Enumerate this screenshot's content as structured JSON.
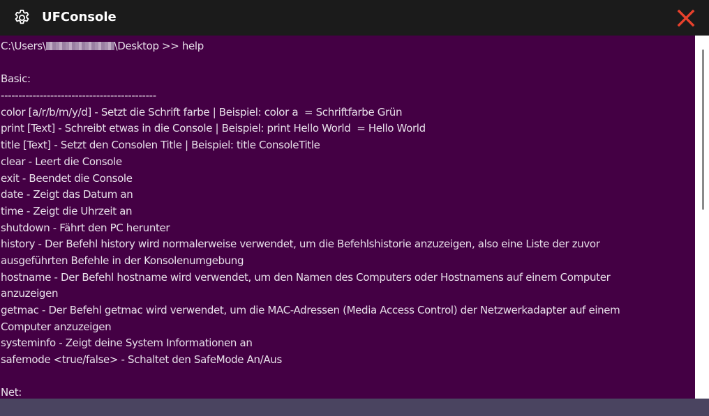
{
  "window": {
    "title": "UFConsole",
    "icon": "gear-icon",
    "close_icon": "close-icon",
    "colors": {
      "titlebar_bg": "#1b1b1b",
      "console_bg": "#440044",
      "console_text": "#e8e0ea",
      "close": "#e8412c",
      "footer_bg": "#4a4460"
    }
  },
  "console": {
    "prompt_prefix": "C:\\Users\\",
    "prompt_suffix": "\\Desktop >> help",
    "lines": [
      "",
      "Basic:",
      "--------------------------------------------",
      "color [a/r/b/m/y/d] - Setzt die Schrift farbe | Beispiel: color a  = Schriftfarbe Grün",
      "print [Text] - Schreibt etwas in die Console | Beispiel: print Hello World  = Hello World",
      "title [Text] - Setzt den Consolen Title | Beispiel: title ConsoleTitle",
      "clear - Leert die Console",
      "exit - Beendet die Console",
      "date - Zeigt das Datum an",
      "time - Zeigt die Uhrzeit an",
      "shutdown - Fährt den PC herunter",
      "history - Der Befehl history wird normalerweise verwendet, um die Befehlshistorie anzuzeigen, also eine Liste der zuvor",
      "ausgeführten Befehle in der Konsolenumgebung",
      "hostname - Der Befehl hostname wird verwendet, um den Namen des Computers oder Hostnamens auf einem Computer",
      "anzuzeigen",
      "getmac - Der Befehl getmac wird verwendet, um die MAC-Adressen (Media Access Control) der Netzwerkadapter auf einem",
      "Computer anzuzeigen",
      "systeminfo - Zeigt deine System Informationen an",
      "safemode <true/false> - Schaltet den SafeMode An/Aus",
      "",
      "Net:"
    ]
  }
}
